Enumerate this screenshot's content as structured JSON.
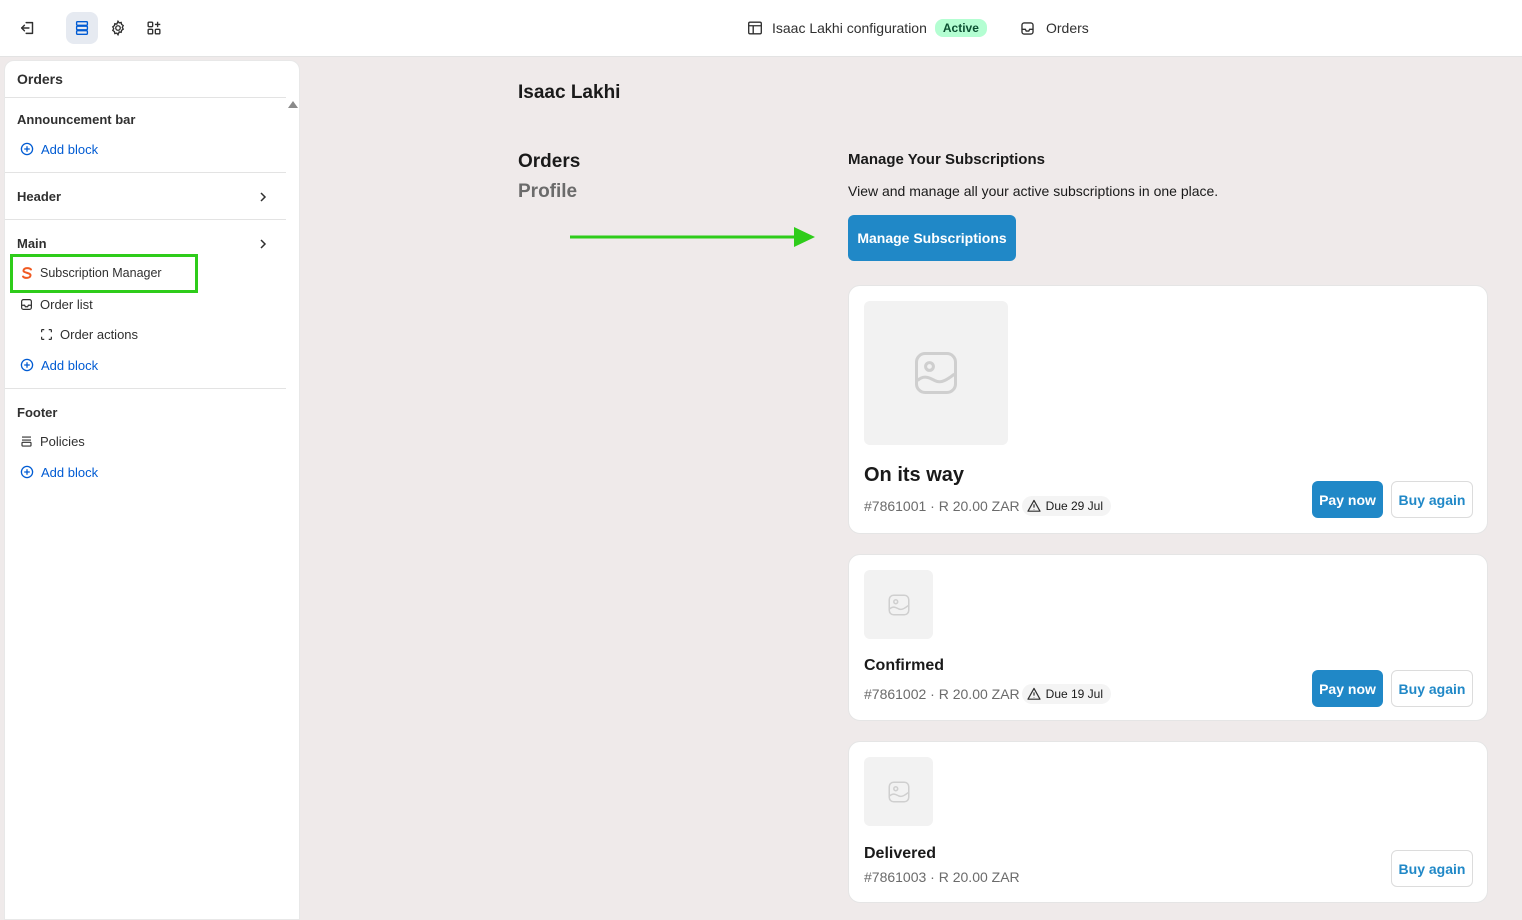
{
  "topbar": {
    "config_label": "Isaac Lakhi configuration",
    "status_badge": "Active",
    "page_label": "Orders"
  },
  "sidebar": {
    "title": "Orders",
    "sections": {
      "announcement": {
        "label": "Announcement bar",
        "add_block": "Add block"
      },
      "header": {
        "label": "Header"
      },
      "main": {
        "label": "Main",
        "items": [
          "Subscription Manager",
          "Order list",
          "Order actions"
        ],
        "add_block": "Add block"
      },
      "footer": {
        "label": "Footer",
        "items": [
          "Policies"
        ],
        "add_block": "Add block"
      }
    }
  },
  "preview": {
    "customer_name": "Isaac Lakhi",
    "nav": [
      "Orders",
      "Profile"
    ],
    "subscriptions": {
      "title": "Manage Your Subscriptions",
      "description": "View and manage all your active subscriptions in one place.",
      "button": "Manage Subscriptions"
    },
    "orders": [
      {
        "status": "On its way",
        "meta": "#7861001 · R 20.00 ZAR",
        "due": "Due 29 Jul",
        "pay": "Pay now",
        "buy": "Buy again"
      },
      {
        "status": "Confirmed",
        "meta": "#7861002 · R 20.00 ZAR",
        "due": "Due 19 Jul",
        "pay": "Pay now",
        "buy": "Buy again"
      },
      {
        "status": "Delivered",
        "meta": "#7861003 · R 20.00 ZAR",
        "buy": "Buy again"
      }
    ]
  },
  "colors": {
    "accent_blue": "#2088c7",
    "badge_green": "#b4fed2",
    "highlight_green": "#2ecc1a",
    "canvas": "#efeaea"
  },
  "icons": [
    "exit-icon",
    "sections-icon",
    "gear-icon",
    "apps-icon",
    "store-icon",
    "inbox-icon",
    "chevron-right-icon",
    "plus-circle-icon",
    "subscription-logo-icon",
    "frame-icon",
    "policies-icon",
    "image-placeholder-icon",
    "warning-icon",
    "arrow-right-icon"
  ]
}
